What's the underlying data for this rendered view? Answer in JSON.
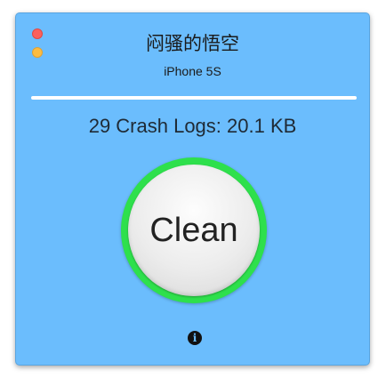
{
  "window": {
    "title": "闷骚的悟空",
    "subtitle": "iPhone 5S"
  },
  "status": {
    "crash_summary": "29 Crash Logs: 20.1 KB"
  },
  "clean_button": {
    "label": "Clean"
  },
  "info_button": {
    "glyph": "i",
    "icon": "info-icon"
  },
  "colors": {
    "window_background": "#6bbdfd",
    "ring": "#2ee04c",
    "close": "#fc605c",
    "minimize": "#fdbc40"
  }
}
